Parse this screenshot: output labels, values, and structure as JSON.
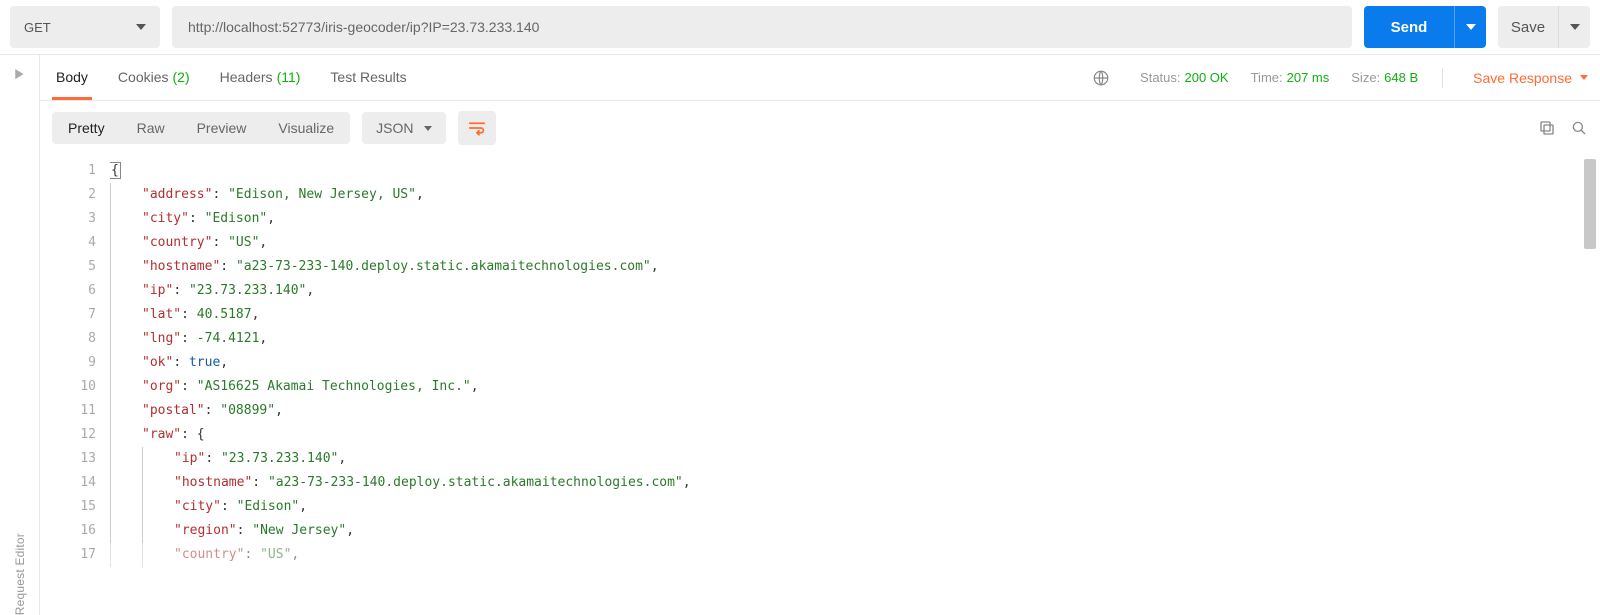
{
  "request": {
    "method": "GET",
    "url": "http://localhost:52773/iris-geocoder/ip?IP=23.73.233.140",
    "send_label": "Send",
    "save_label": "Save"
  },
  "left_gutter": {
    "label": "Request Editor"
  },
  "tabs": {
    "body": "Body",
    "cookies": {
      "label": "Cookies",
      "count": "(2)"
    },
    "headers": {
      "label": "Headers",
      "count": "(11)"
    },
    "test_results": "Test Results"
  },
  "status": {
    "status_label": "Status:",
    "status_value": "200 OK",
    "time_label": "Time:",
    "time_value": "207 ms",
    "size_label": "Size:",
    "size_value": "648 B",
    "save_response": "Save Response"
  },
  "view_modes": {
    "pretty": "Pretty",
    "raw": "Raw",
    "preview": "Preview",
    "visualize": "Visualize",
    "format": "JSON"
  },
  "response_body": {
    "address": "Edison, New Jersey, US",
    "city": "Edison",
    "country": "US",
    "hostname": "a23-73-233-140.deploy.static.akamaitechnologies.com",
    "ip": "23.73.233.140",
    "lat": 40.5187,
    "lng": -74.4121,
    "ok": true,
    "org": "AS16625 Akamai Technologies, Inc.",
    "postal": "08899",
    "raw": {
      "ip": "23.73.233.140",
      "hostname": "a23-73-233-140.deploy.static.akamaitechnologies.com",
      "city": "Edison",
      "region": "New Jersey",
      "country": "US"
    }
  },
  "code_lines": [
    {
      "n": 1,
      "indent": 0,
      "open": "{"
    },
    {
      "n": 2,
      "indent": 1,
      "key": "address",
      "type": "string",
      "path": "response_body.address"
    },
    {
      "n": 3,
      "indent": 1,
      "key": "city",
      "type": "string",
      "path": "response_body.city"
    },
    {
      "n": 4,
      "indent": 1,
      "key": "country",
      "type": "string",
      "path": "response_body.country"
    },
    {
      "n": 5,
      "indent": 1,
      "key": "hostname",
      "type": "string",
      "path": "response_body.hostname"
    },
    {
      "n": 6,
      "indent": 1,
      "key": "ip",
      "type": "string",
      "path": "response_body.ip"
    },
    {
      "n": 7,
      "indent": 1,
      "key": "lat",
      "type": "number",
      "path": "response_body.lat"
    },
    {
      "n": 8,
      "indent": 1,
      "key": "lng",
      "type": "number",
      "path": "response_body.lng"
    },
    {
      "n": 9,
      "indent": 1,
      "key": "ok",
      "type": "bool",
      "path": "response_body.ok"
    },
    {
      "n": 10,
      "indent": 1,
      "key": "org",
      "type": "string",
      "path": "response_body.org"
    },
    {
      "n": 11,
      "indent": 1,
      "key": "postal",
      "type": "string",
      "path": "response_body.postal"
    },
    {
      "n": 12,
      "indent": 1,
      "key": "raw",
      "type": "open"
    },
    {
      "n": 13,
      "indent": 2,
      "key": "ip",
      "type": "string",
      "path": "response_body.raw.ip"
    },
    {
      "n": 14,
      "indent": 2,
      "key": "hostname",
      "type": "string",
      "path": "response_body.raw.hostname"
    },
    {
      "n": 15,
      "indent": 2,
      "key": "city",
      "type": "string",
      "path": "response_body.raw.city"
    },
    {
      "n": 16,
      "indent": 2,
      "key": "region",
      "type": "string",
      "path": "response_body.raw.region"
    },
    {
      "n": 17,
      "indent": 2,
      "key": "country",
      "type": "string",
      "path": "response_body.raw.country",
      "faded": true
    }
  ]
}
